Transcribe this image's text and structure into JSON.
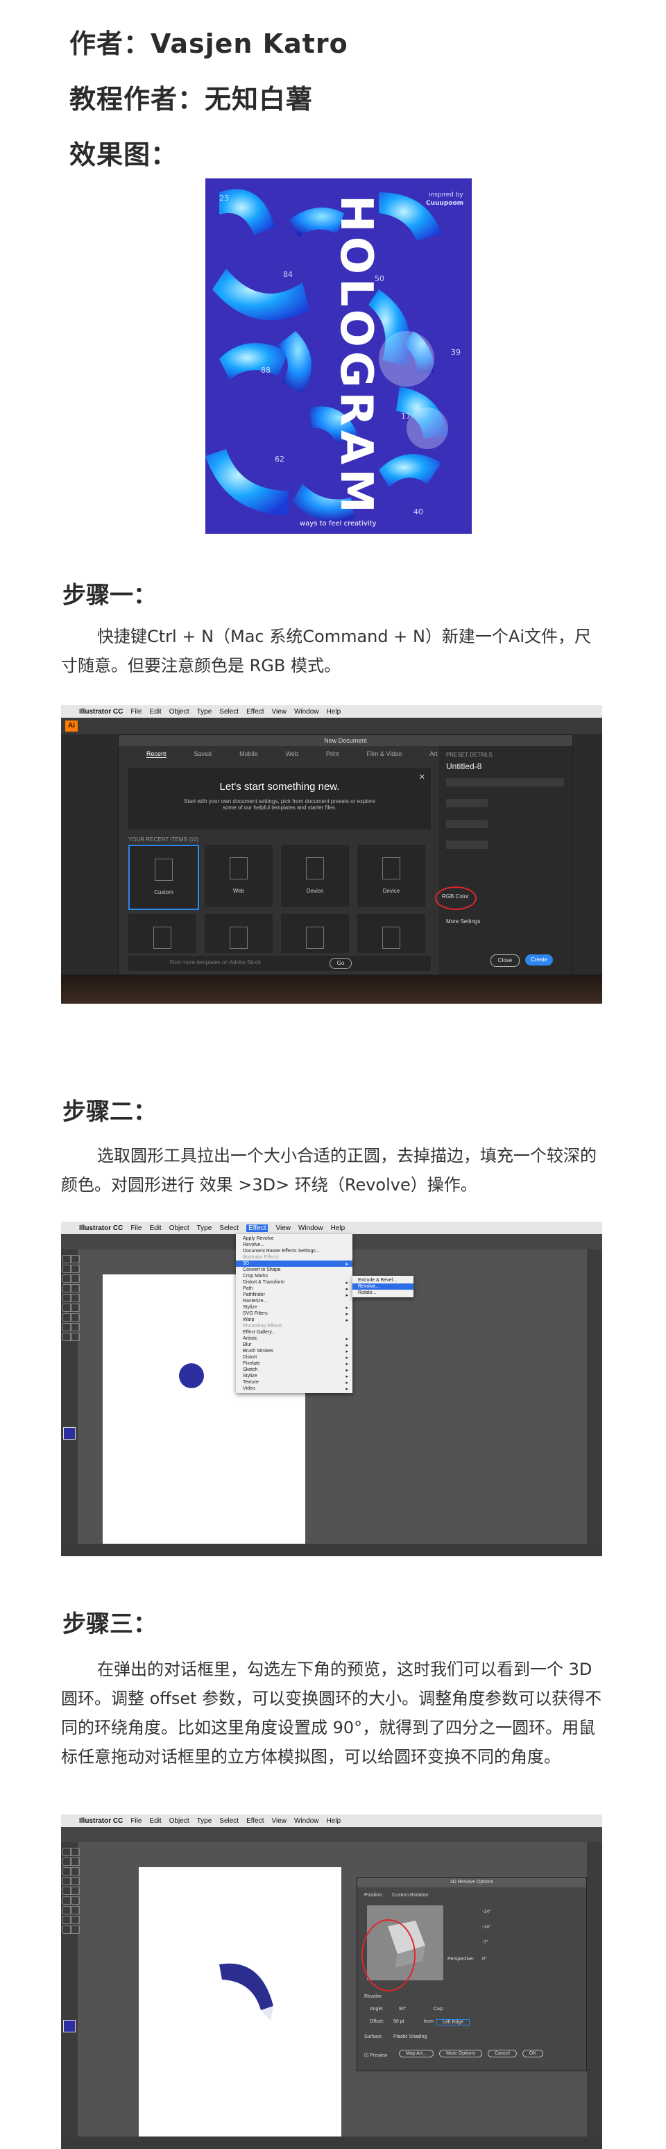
{
  "header": {
    "author": "作者：Vasjen Katro",
    "tutorial_author": "教程作者：无知白薯",
    "effect_label": "效果图："
  },
  "poster": {
    "title": "HOLOGRAM",
    "top_right": "inspired by\nCuuupoom",
    "tagline": "ways to feel creativity",
    "numbers": [
      "23",
      "84",
      "50",
      "39",
      "88",
      "17",
      "62",
      "40"
    ],
    "colors": {
      "bg": "#3a2fb8",
      "accent": "#1aa6ff",
      "deep": "#221a78"
    }
  },
  "step1": {
    "title": "步骤一：",
    "text": "快捷键Ctrl + N（Mac 系统Command + N）新建一个Ai文件，尺寸随意。但要注意颜色是 RGB 模式。",
    "screenshot": {
      "app": "Illustrator CC",
      "menus": [
        "File",
        "Edit",
        "Object",
        "Type",
        "Select",
        "Effect",
        "View",
        "Window",
        "Help"
      ],
      "dialog_title": "New Document",
      "tabs": [
        "Recent",
        "Saved",
        "Mobile",
        "Web",
        "Print",
        "Film & Video",
        "Art & Illustration"
      ],
      "banner_title": "Let's start something new.",
      "banner_text": "Start with your own document settings, pick from document presets or explore some of our helpful templates and starter files.",
      "recent_label": "YOUR RECENT ITEMS (10)",
      "items": [
        "Custom",
        "Web",
        "Device",
        "Device"
      ],
      "search_placeholder": "Find more templates on Adobe Stock",
      "go": "Go",
      "preset_label": "PRESET DETAILS",
      "preset_name": "Untitled-8",
      "color_mode": "RGB Color",
      "more": "More Settings",
      "close": "Close",
      "create": "Create"
    }
  },
  "step2": {
    "title": "步骤二：",
    "text": "选取圆形工具拉出一个大小合适的正圆，去掉描边，填充一个较深的颜色。对圆形进行 效果 >3D> 环绕（Revolve）操作。",
    "screenshot": {
      "effect_menu": [
        "Apply Revolve",
        "Revolve...",
        "Document Raster Effects Settings...",
        "Illustrator Effects",
        "3D",
        "Convert to Shape",
        "Crop Marks",
        "Distort & Transform",
        "Path",
        "Pathfinder",
        "Rasterize...",
        "Stylize",
        "SVG Filters",
        "Warp",
        "Photoshop Effects",
        "Effect Gallery...",
        "Artistic",
        "Blur",
        "Brush Strokes",
        "Distort",
        "Pixelate",
        "Sketch",
        "Stylize",
        "Texture",
        "Video"
      ],
      "submenu_3d": [
        "Extrude & Bevel...",
        "Revolve...",
        "Rotate..."
      ],
      "circle_color": "#2d2fa0"
    }
  },
  "step3": {
    "title": "步骤三：",
    "text": "在弹出的对话框里，勾选左下角的预览，这时我们可以看到一个 3D 圆环。调整 offset 参数，可以变换圆环的大小。调整角度参数可以获得不同的环绕角度。比如这里角度设置成 90°，就得到了四分之一圆环。用鼠标任意拖动对话框里的立方体模拟图，可以给圆环变换不同的角度。",
    "screenshot": {
      "dialog_title": "3D Revolve Options",
      "position_label": "Position:",
      "position_value": "Custom Rotation",
      "rot_values": [
        "-14°",
        "-14°",
        "-7°"
      ],
      "perspective_label": "Perspective:",
      "perspective_value": "0°",
      "revolve_label": "Revolve",
      "angle_label": "Angle:",
      "angle_value": "90°",
      "cap_label": "Cap:",
      "offset_label": "Offset:",
      "offset_value": "50 pt",
      "from_label": "from",
      "from_value": "Left Edge",
      "surface_label": "Surface:",
      "surface_value": "Plastic Shading",
      "preview_label": "Preview",
      "buttons": [
        "Map Art...",
        "More Options",
        "Cancel",
        "OK"
      ],
      "ring_color": "#2b2e8f"
    }
  }
}
